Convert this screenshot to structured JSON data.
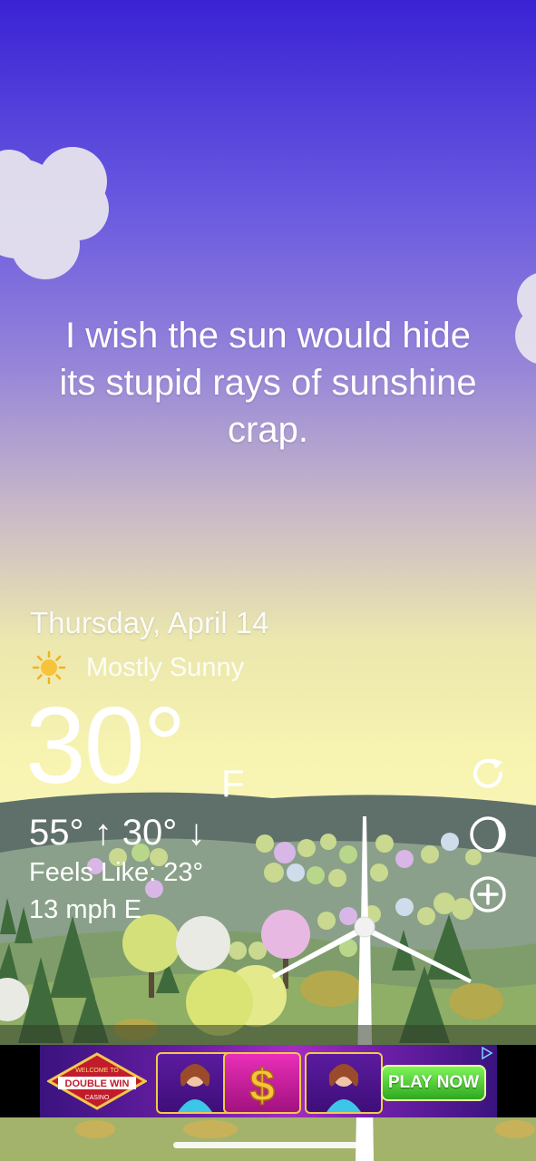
{
  "quote": {
    "line1": "I wish the sun would hide",
    "line2": "its stupid rays of sunshine",
    "line3": "crap."
  },
  "weather": {
    "date": "Thursday, April 14",
    "condition": "Mostly Sunny",
    "condition_icon": "sun-icon",
    "temperature": "30°",
    "unit": "F",
    "hi_lo": "55° ↑  30° ↓",
    "feels_like": "Feels Like: 23°",
    "wind": "13 mph E"
  },
  "controls": {
    "refresh_icon": "refresh-icon",
    "moon_icon": "moon-phase-icon",
    "add_icon": "add-location-icon"
  },
  "ad": {
    "brand_top": "WELCOME TO",
    "brand": "DOUBLE WIN",
    "brand_sub": "CASINO",
    "cta": "PLAY NOW",
    "slot_symbol": "$"
  },
  "colors": {
    "sky_top": "#3a22d4",
    "sky_bottom": "#faf6b7",
    "text": "#ffffff",
    "cta_green": "#2ea81f"
  }
}
